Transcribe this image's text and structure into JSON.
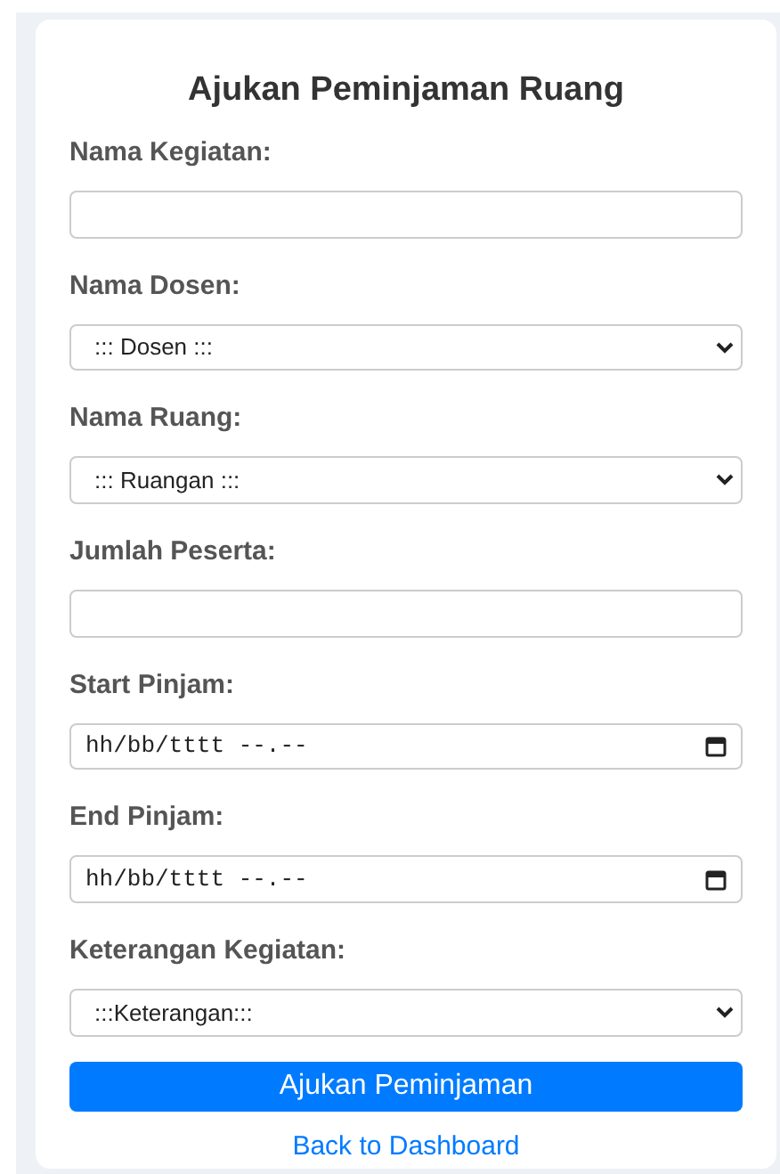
{
  "title": "Ajukan Peminjaman Ruang",
  "fields": [
    {
      "label": "Nama Kegiatan:",
      "kind": "text"
    },
    {
      "label": "Nama Dosen:",
      "kind": "select",
      "value": "::: Dosen :::"
    },
    {
      "label": "Nama Ruang:",
      "kind": "select",
      "value": "::: Ruangan :::"
    },
    {
      "label": "Jumlah Peserta:",
      "kind": "text"
    },
    {
      "label": "Start Pinjam:",
      "kind": "datetime",
      "value": "hh/bb/tttt --.--"
    },
    {
      "label": "End Pinjam:",
      "kind": "datetime",
      "value": "hh/bb/tttt --.--"
    },
    {
      "label": "Keterangan Kegiatan:",
      "kind": "select",
      "value": ":::Keterangan:::"
    }
  ],
  "submit_button": "Ajukan Peminjaman",
  "back_link": "Back to Dashboard"
}
